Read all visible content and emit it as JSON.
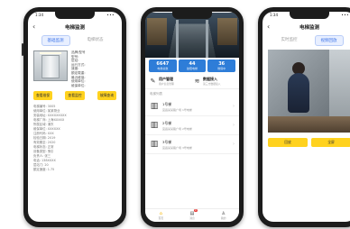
{
  "phones": {
    "left": {
      "status": {
        "time": "1:34",
        "signal": "•••"
      },
      "title": "电梯监测",
      "tabs": [
        "基础监测",
        "电梯状态"
      ],
      "specs": [
        "品牌/型号",
        "型号:",
        "层站:",
        "运行方式:",
        "速度:",
        "额定载重:",
        "最近维保:",
        "使用单位:",
        "维保单位:"
      ],
      "buttons": [
        "查看维保",
        "查看监控",
        "故障查询"
      ],
      "info": [
        "电梯编号: 3005",
        "使用单位: 某某物业",
        "安装地址: XXXXXXXXX",
        "电梯厂商: 上海XXXXX",
        "所属区域: 浦东",
        "维保单位: XXXXXX",
        "注册代码: XXX",
        "检验日期: 2019",
        "有效期至: 2020",
        "电梯状态: 正常",
        "设备类型: 曳引",
        "负责人: 张三",
        "电话: 138XXXX",
        "层站门: 20",
        "额定速度: 1.75"
      ]
    },
    "middle": {
      "stats": [
        {
          "num": "6647",
          "label": "电梯总数"
        },
        {
          "num": "44",
          "label": "故障电梯"
        },
        {
          "num": "36",
          "label": "维保中"
        }
      ],
      "actions": [
        {
          "title": "用户管理",
          "sub": "用户信息管理"
        },
        {
          "title": "数据接入",
          "sub": "第三方数据接入"
        }
      ],
      "section_title": "电梯列表",
      "items": [
        {
          "name": "1号梯",
          "addr": "宜昌某某路广场 1号电梯"
        },
        {
          "name": "2号梯",
          "addr": "宜昌某某路广场 2号电梯"
        },
        {
          "name": "3号梯",
          "addr": "宜昌某某路广场 3号电梯"
        }
      ],
      "bottom_tabs": [
        {
          "label": "首页",
          "icon": "home-icon"
        },
        {
          "label": "消息",
          "icon": "message-icon",
          "badge": "9"
        },
        {
          "label": "我的",
          "icon": "user-icon"
        }
      ]
    },
    "right": {
      "status": {
        "time": "1:34",
        "signal": "•••"
      },
      "title": "电梯监测",
      "tabs": [
        "实时监控",
        "视频回放"
      ],
      "buttons": [
        "回放",
        "全屏"
      ]
    }
  },
  "colors": {
    "accent_yellow": "#ffd21f",
    "stat_blue": "#2e7dd8",
    "tab_blue": "#3a72e8"
  }
}
